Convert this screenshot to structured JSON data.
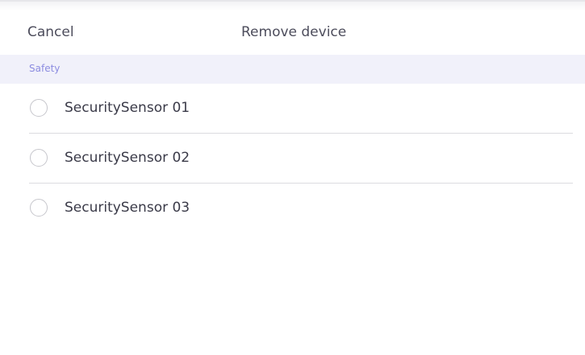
{
  "header": {
    "cancel_label": "Cancel",
    "title": "Remove device"
  },
  "section": {
    "label": "Safety"
  },
  "devices": [
    {
      "label": "SecuritySensor 01",
      "selected": false
    },
    {
      "label": "SecuritySensor 02",
      "selected": false
    },
    {
      "label": "SecuritySensor 03",
      "selected": false
    }
  ],
  "colors": {
    "section_background": "#f1f1fa",
    "section_text": "#8c8ce0",
    "text": "#3a3a48",
    "radio_border": "#c6c6cc",
    "divider": "#dcdce0"
  }
}
